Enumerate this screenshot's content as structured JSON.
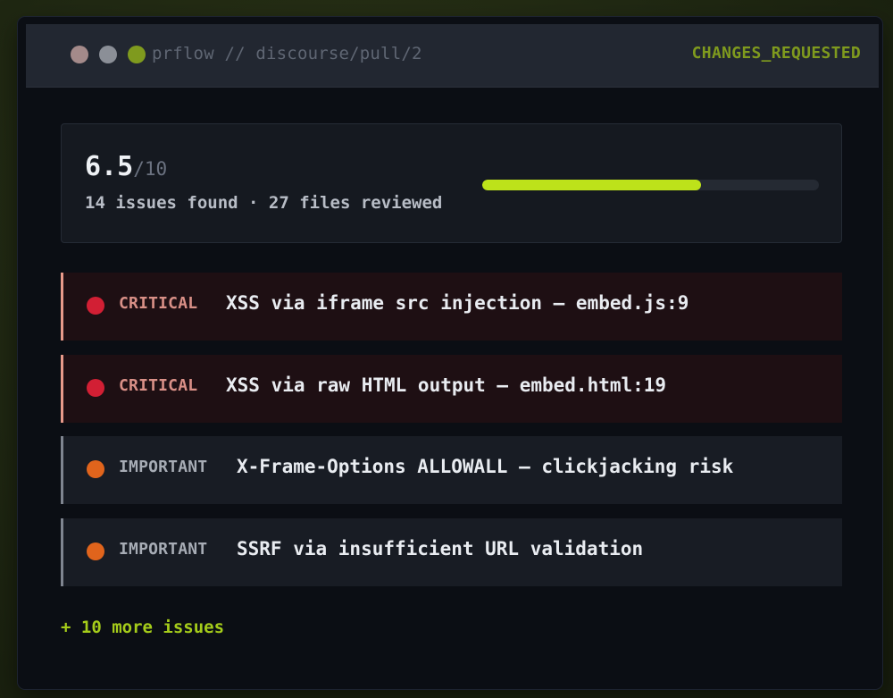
{
  "header": {
    "title": "prflow // discourse/pull/2",
    "status": "CHANGES_REQUESTED",
    "window_controls": [
      "close-dot",
      "minimize-dot",
      "maximize-dot"
    ]
  },
  "score": {
    "value": "6.5",
    "max": "/10",
    "summary": "14 issues found · 27 files reviewed",
    "progress_fraction": 0.65
  },
  "issues": [
    {
      "severity": "CRITICAL",
      "text": "XSS via iframe src injection — embed.js:9"
    },
    {
      "severity": "CRITICAL",
      "text": "XSS via raw HTML output — embed.html:19"
    },
    {
      "severity": "IMPORTANT",
      "text": "X-Frame-Options ALLOWALL — clickjacking risk"
    },
    {
      "severity": "IMPORTANT",
      "text": "SSRF via insufficient URL validation"
    }
  ],
  "more_issues": "+ 10 more issues",
  "colors": {
    "accent": "#bde21a",
    "critical": "#d21f34",
    "important": "#e0641c",
    "status": "#7f9a1e"
  }
}
